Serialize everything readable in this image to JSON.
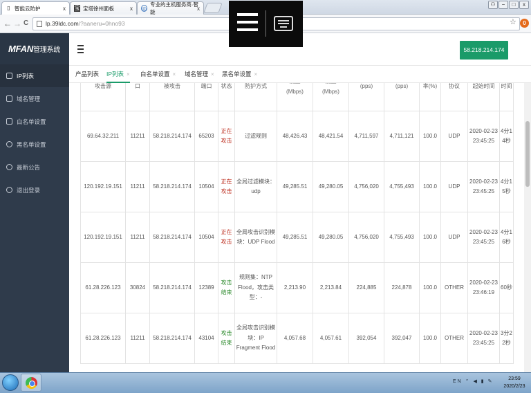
{
  "browser": {
    "tabs": [
      {
        "title": "智能云防护",
        "active": true
      },
      {
        "title": "宝塔徐州面板",
        "active": false
      },
      {
        "title": "专业的主机服务商·智能",
        "active": false
      }
    ],
    "url_host": "lp.39ldc.com",
    "url_path": "/?aaneru=0hno93",
    "nav_back": "←",
    "nav_forward": "→",
    "nav_reload": "C",
    "star": "☆",
    "ext_badge": "0",
    "tab_close": "x",
    "win_user": "⚇",
    "win_min": "−",
    "win_max": "□",
    "win_close": "x"
  },
  "app": {
    "logo_brand": "MFAN",
    "logo_suffix": "管理系统",
    "header_ip": "58.218.214.174",
    "sidebar": [
      {
        "label": "IP列表",
        "active": true
      },
      {
        "label": "域名管理",
        "active": false
      },
      {
        "label": "白名单设置",
        "active": false
      },
      {
        "label": "黑名单设置",
        "active": false
      },
      {
        "label": "最新公告",
        "active": false
      },
      {
        "label": "退出登录",
        "active": false
      }
    ],
    "tabs": [
      {
        "label": "产品列表",
        "closable": false,
        "active": false
      },
      {
        "label": "IP列表",
        "closable": true,
        "active": true
      },
      {
        "label": "白名单设置",
        "closable": true,
        "active": false
      },
      {
        "label": "域名管理",
        "closable": true,
        "active": false
      },
      {
        "label": "黑名单设置",
        "closable": true,
        "active": false
      }
    ],
    "close_glyph": "×"
  },
  "table": {
    "headers": [
      "攻击源",
      "口",
      "被攻击",
      "端口",
      "状态",
      "防护方式",
      "流量\n(Mbps)",
      "流量\n(Mbps)",
      "(pps)",
      "(pps)",
      "率(%)",
      "协议",
      "起始时间",
      "时间"
    ],
    "rows": [
      {
        "src": "69.64.32.211",
        "port1": "11211",
        "target": "58.218.214.174",
        "port2": "65203",
        "status": "正在攻击",
        "status_type": "attack",
        "method": "过滤规则",
        "in_mbps": "48,426.43",
        "out_mbps": "48,421.54",
        "in_pps": "4,711,597",
        "out_pps": "4,711,121",
        "rate": "100.0",
        "proto": "UDP",
        "start": "2020-02-23 23:45:25",
        "duration": "4分14秒"
      },
      {
        "src": "120.192.19.151",
        "port1": "11211",
        "target": "58.218.214.174",
        "port2": "10504",
        "status": "正在攻击",
        "status_type": "attack",
        "method": "全局过滤模块：udp",
        "in_mbps": "49,285.51",
        "out_mbps": "49,280.05",
        "in_pps": "4,756,020",
        "out_pps": "4,755,493",
        "rate": "100.0",
        "proto": "UDP",
        "start": "2020-02-23 23:45:25",
        "duration": "4分15秒"
      },
      {
        "src": "120.192.19.151",
        "port1": "11211",
        "target": "58.218.214.174",
        "port2": "10504",
        "status": "正在攻击",
        "status_type": "attack",
        "method": "全局攻击识别模块：UDP Flood",
        "in_mbps": "49,285.51",
        "out_mbps": "49,280.05",
        "in_pps": "4,756,020",
        "out_pps": "4,755,493",
        "rate": "100.0",
        "proto": "UDP",
        "start": "2020-02-23 23:45:25",
        "duration": "4分16秒"
      },
      {
        "src": "61.28.226.123",
        "port1": "30824",
        "target": "58.218.214.174",
        "port2": "12389",
        "status": "攻击结束",
        "status_type": "end",
        "method": "规则集：NTP Flood，攻击类型：-",
        "in_mbps": "2,213.90",
        "out_mbps": "2,213.84",
        "in_pps": "224,885",
        "out_pps": "224,878",
        "rate": "100.0",
        "proto": "OTHER",
        "start": "2020-02-23 23:46:19",
        "duration": "60秒"
      },
      {
        "src": "61.28.226.123",
        "port1": "11211",
        "target": "58.218.214.174",
        "port2": "43104",
        "status": "攻击结束",
        "status_type": "end",
        "method": "全局攻击识别模块：IP Fragment Flood",
        "in_mbps": "4,057.68",
        "out_mbps": "4,057.61",
        "in_pps": "392,054",
        "out_pps": "392,047",
        "rate": "100.0",
        "proto": "OTHER",
        "start": "2020-02-23 23:45:25",
        "duration": "3分22秒"
      }
    ]
  },
  "taskbar": {
    "clock_time": "23:59",
    "clock_date": "2020/2/23",
    "tray_text": "EN ⌃ ◀ ▮ ✎"
  }
}
